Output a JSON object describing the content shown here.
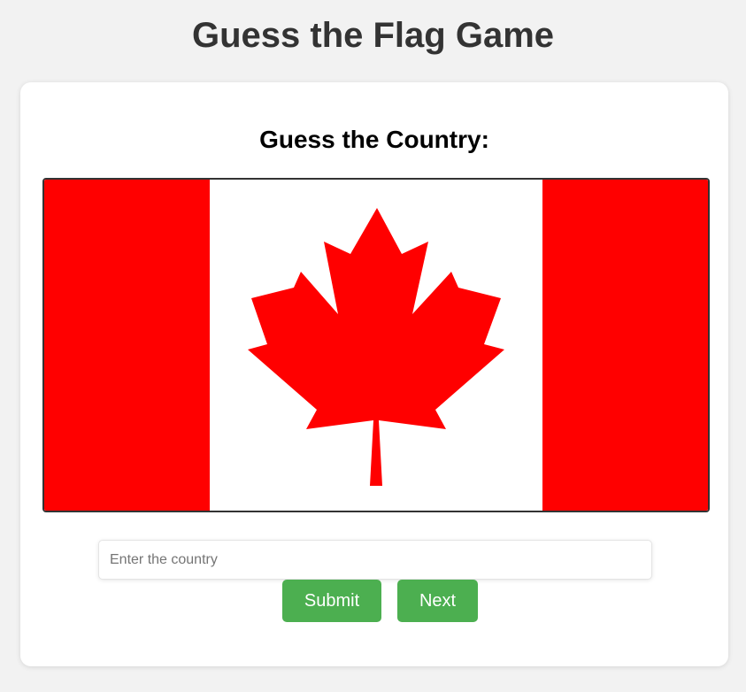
{
  "header": {
    "title": "Guess the Flag Game"
  },
  "game": {
    "prompt": "Guess the Country:",
    "flag": {
      "icon": "canada-flag",
      "colors": {
        "red": "#ff0000",
        "white": "#ffffff"
      }
    },
    "answer": {
      "value": "",
      "placeholder": "Enter the country"
    },
    "submit_label": "Submit",
    "next_label": "Next"
  },
  "colors": {
    "background": "#f2f2f2",
    "card": "#ffffff",
    "button": "#4caf50",
    "title": "#333333"
  }
}
